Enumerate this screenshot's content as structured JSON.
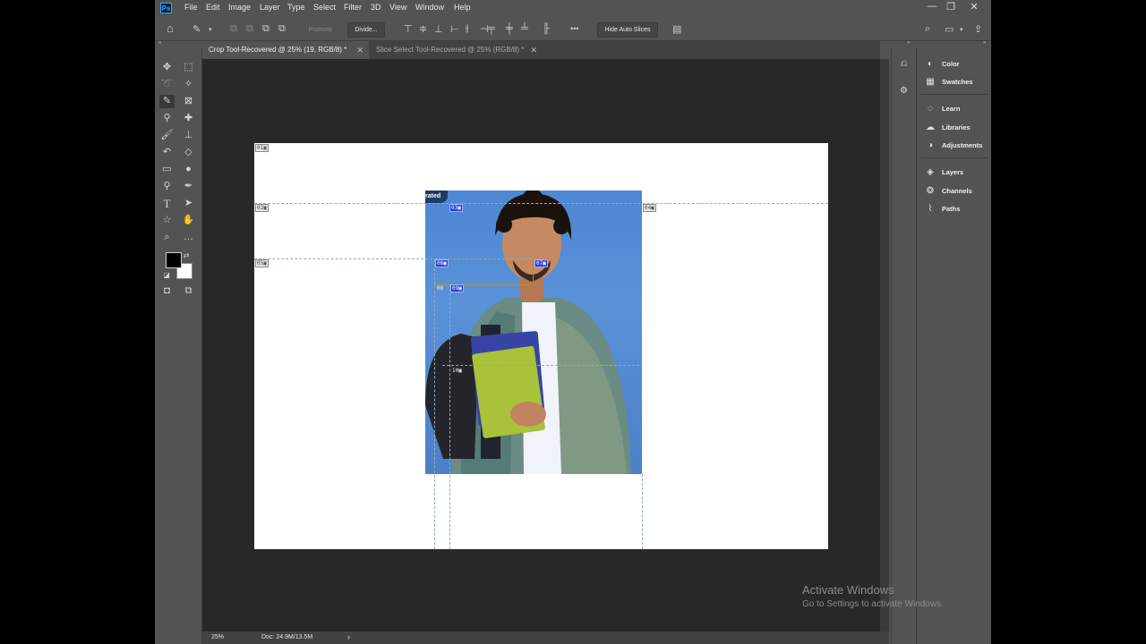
{
  "menubar": {
    "logo": "Ps",
    "items": [
      "File",
      "Edit",
      "Image",
      "Layer",
      "Type",
      "Select",
      "Filter",
      "3D",
      "View",
      "Window",
      "Help"
    ],
    "window_controls": {
      "minimize": "—",
      "restore": "❐",
      "close": "✕"
    }
  },
  "options": {
    "promote_label": "Promote",
    "divide_label": "Divide...",
    "more_label": "•••",
    "hide_auto_slices_label": "Hide Auto Slices"
  },
  "tabs": [
    {
      "label": "Crop Tool-Recovered @ 25% (19, RGB/8) *",
      "active": true
    },
    {
      "label": "Slice Select Tool-Recovered @ 25% (RGB/8) *",
      "active": false
    }
  ],
  "canvas": {
    "badge": "rated",
    "slices": [
      {
        "id": "01",
        "type": "auto"
      },
      {
        "id": "02",
        "type": "auto"
      },
      {
        "id": "03",
        "type": "user"
      },
      {
        "id": "04",
        "type": "auto"
      },
      {
        "id": "05",
        "type": "auto"
      },
      {
        "id": "06",
        "type": "user"
      },
      {
        "id": "07",
        "type": "selected"
      },
      {
        "id": "08",
        "type": "user-white"
      },
      {
        "id": "09",
        "type": "user"
      },
      {
        "id": "10",
        "type": "user-white"
      }
    ],
    "slice_icon": "▣"
  },
  "status": {
    "zoom": "25%",
    "doc": "Doc: 24.9M/13.5M",
    "arrow": "›"
  },
  "panels": [
    {
      "label": "Color",
      "icon": "color-icon"
    },
    {
      "label": "Swatches",
      "icon": "swatches-icon"
    },
    {
      "label": "Learn",
      "icon": "learn-icon"
    },
    {
      "label": "Libraries",
      "icon": "libraries-icon"
    },
    {
      "label": "Adjustments",
      "icon": "adjustments-icon"
    },
    {
      "label": "Layers",
      "icon": "layers-icon"
    },
    {
      "label": "Channels",
      "icon": "channels-icon"
    },
    {
      "label": "Paths",
      "icon": "paths-icon"
    }
  ],
  "colors": {
    "foreground": "#000000",
    "background": "#ffffff",
    "accent": "#31a8ff"
  },
  "watermark": {
    "title": "Activate Windows",
    "subtitle": "Go to Settings to activate Windows."
  }
}
